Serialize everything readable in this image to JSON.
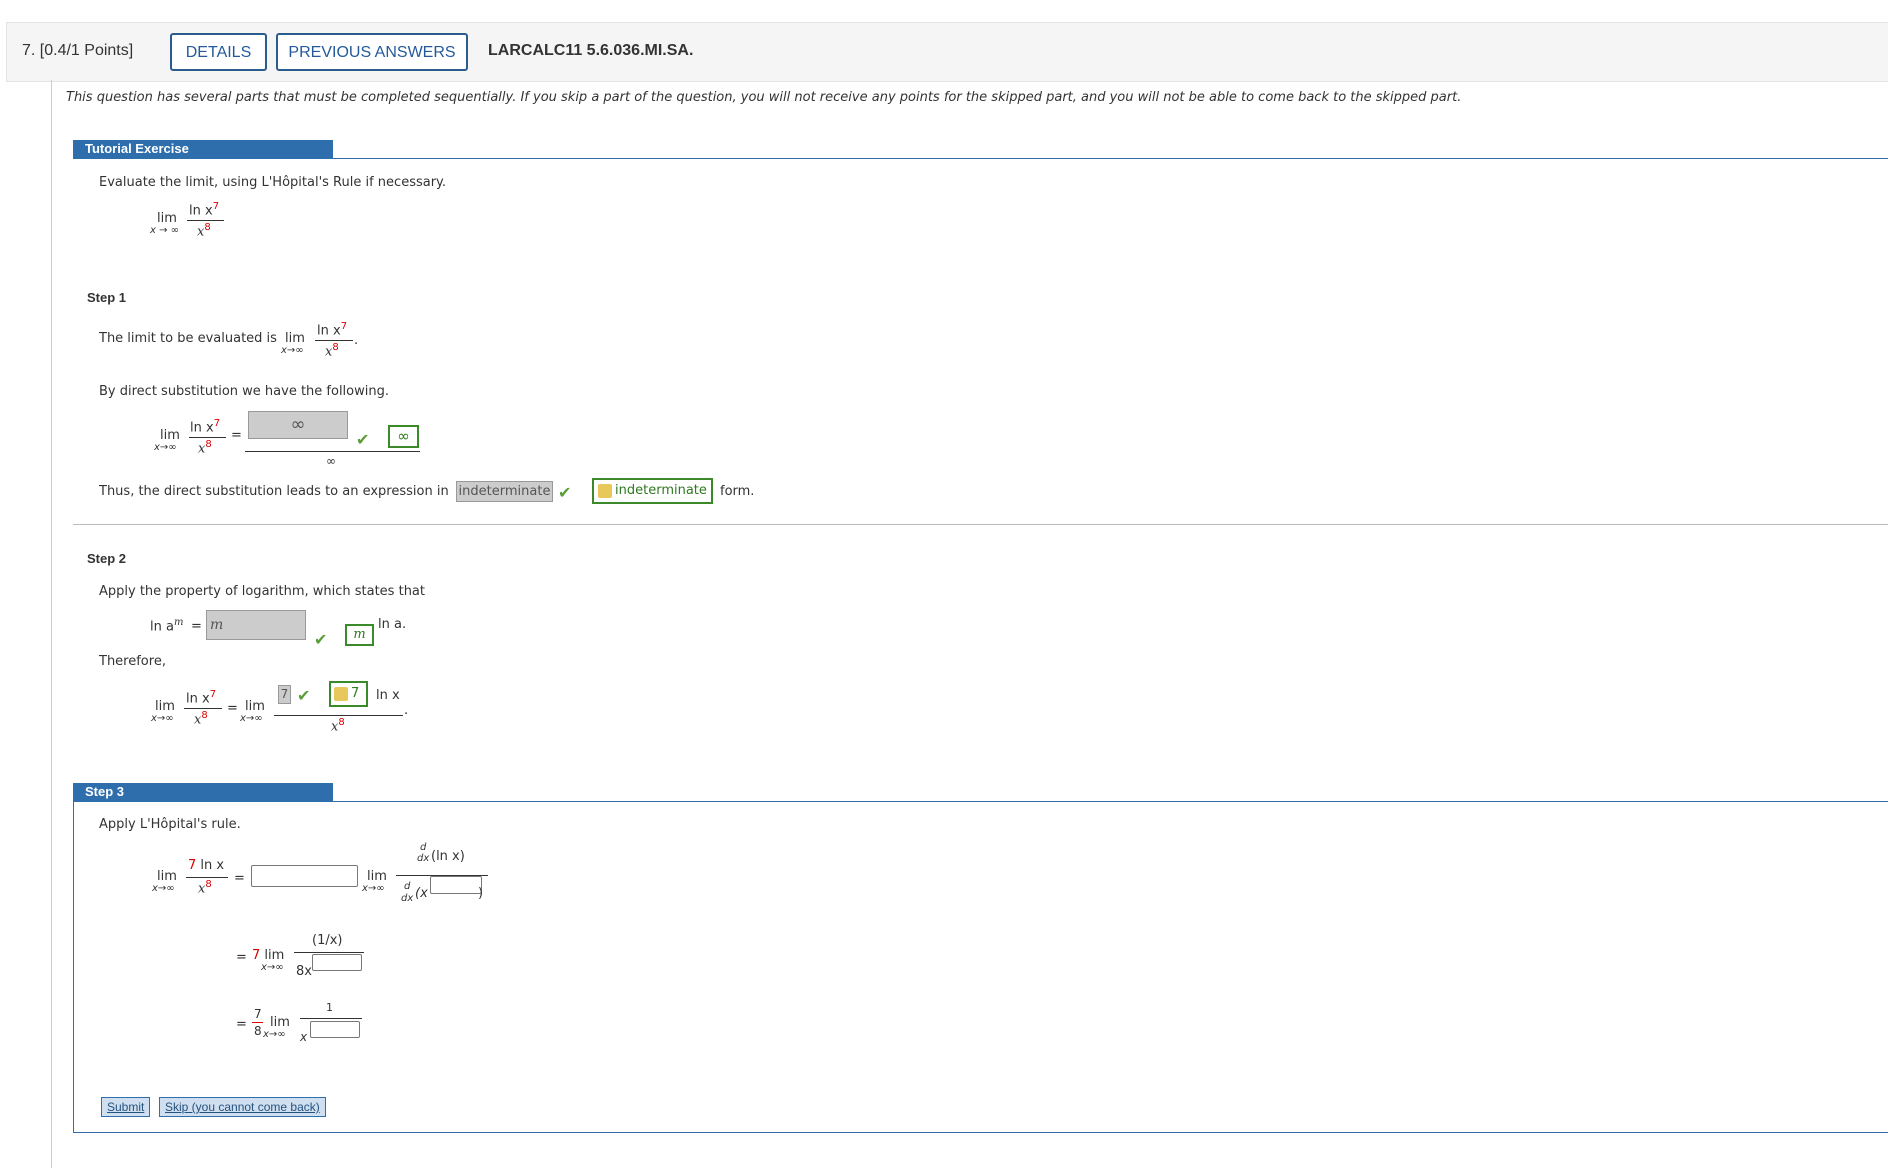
{
  "header": {
    "question_number": "7.",
    "points": "[0.4/1 Points]",
    "details_button": "DETAILS",
    "previous_answers_button": "PREVIOUS ANSWERS",
    "problem_code": "LARCALC11 5.6.036.MI.SA."
  },
  "intro": "This question has several parts that must be completed sequentially. If you skip a part of the question, you will not receive any points for the skipped part, and you will not be able to come back to the skipped part.",
  "tutorial": {
    "tab_label": "Tutorial Exercise",
    "prompt": "Evaluate the limit, using L'Hôpital's Rule if necessary.",
    "limit": {
      "lim": "lim",
      "sub": "x → ∞",
      "numerator": "ln x",
      "num_exp": "7",
      "denominator": "x",
      "den_exp": "8"
    }
  },
  "step1": {
    "title": "Step 1",
    "text": "The limit to be evaluated is",
    "limit": {
      "lim": "lim",
      "sub": "x→∞",
      "numerator": "ln x",
      "num_exp": "7",
      "denominator": "x",
      "den_exp": "8"
    },
    "period": ".",
    "direct_text": "By direct substitution we have the following.",
    "eq_lim": "lim",
    "eq_sub": "x→∞",
    "equals": "=",
    "submitted_answer": "∞",
    "correct_answer": "∞",
    "denominator_value": "∞",
    "thus_text": "Thus, the direct substitution leads to an expression in",
    "submitted_form": "indeterminate",
    "correct_form": "indeterminate",
    "form_suffix": "form."
  },
  "step2": {
    "title": "Step 2",
    "text": "Apply the property of logarithm, which states that",
    "ln_am": "ln a",
    "am_exp": "m",
    "equals": "=",
    "submitted_answer": "m",
    "correct_answer": "m",
    "ln_a": "ln a.",
    "therefore": "Therefore,",
    "eq": {
      "lim": "lim",
      "sub": "x→∞",
      "numerator": "ln x",
      "num_exp": "7",
      "denominator": "x",
      "den_exp": "8",
      "equals": "=",
      "rhs_lim": "lim",
      "rhs_sub": "x→∞",
      "submitted_coef": "7",
      "correct_coef": "7",
      "ln_x": "ln x",
      "rhs_den": "x",
      "rhs_den_exp": "8",
      "period": "."
    }
  },
  "step3": {
    "tab_label": "Step 3",
    "text": "Apply L'Hôpital's rule.",
    "line1": {
      "lim": "lim",
      "sub": "x→∞",
      "num_coef": "7",
      "num_rest": "ln x",
      "den": "x",
      "den_exp": "8",
      "equals": "=",
      "rhs_lim": "lim",
      "rhs_sub": "x→∞",
      "d": "d",
      "dx": "dx",
      "ln_x_paren": "(ln x)",
      "paren_open": "(x",
      "paren_close": ")"
    },
    "line2": {
      "equals": "=",
      "coef": "7",
      "lim": "lim",
      "sub": "x→∞",
      "numerator": "(1/x)",
      "den": "8x"
    },
    "line3": {
      "equals": "=",
      "coef_num": "7",
      "coef_den": "8",
      "lim": "lim",
      "sub": "x→∞",
      "numerator": "1",
      "den": "x"
    }
  },
  "buttons": {
    "submit": "Submit",
    "skip": "Skip (you cannot come back)"
  }
}
